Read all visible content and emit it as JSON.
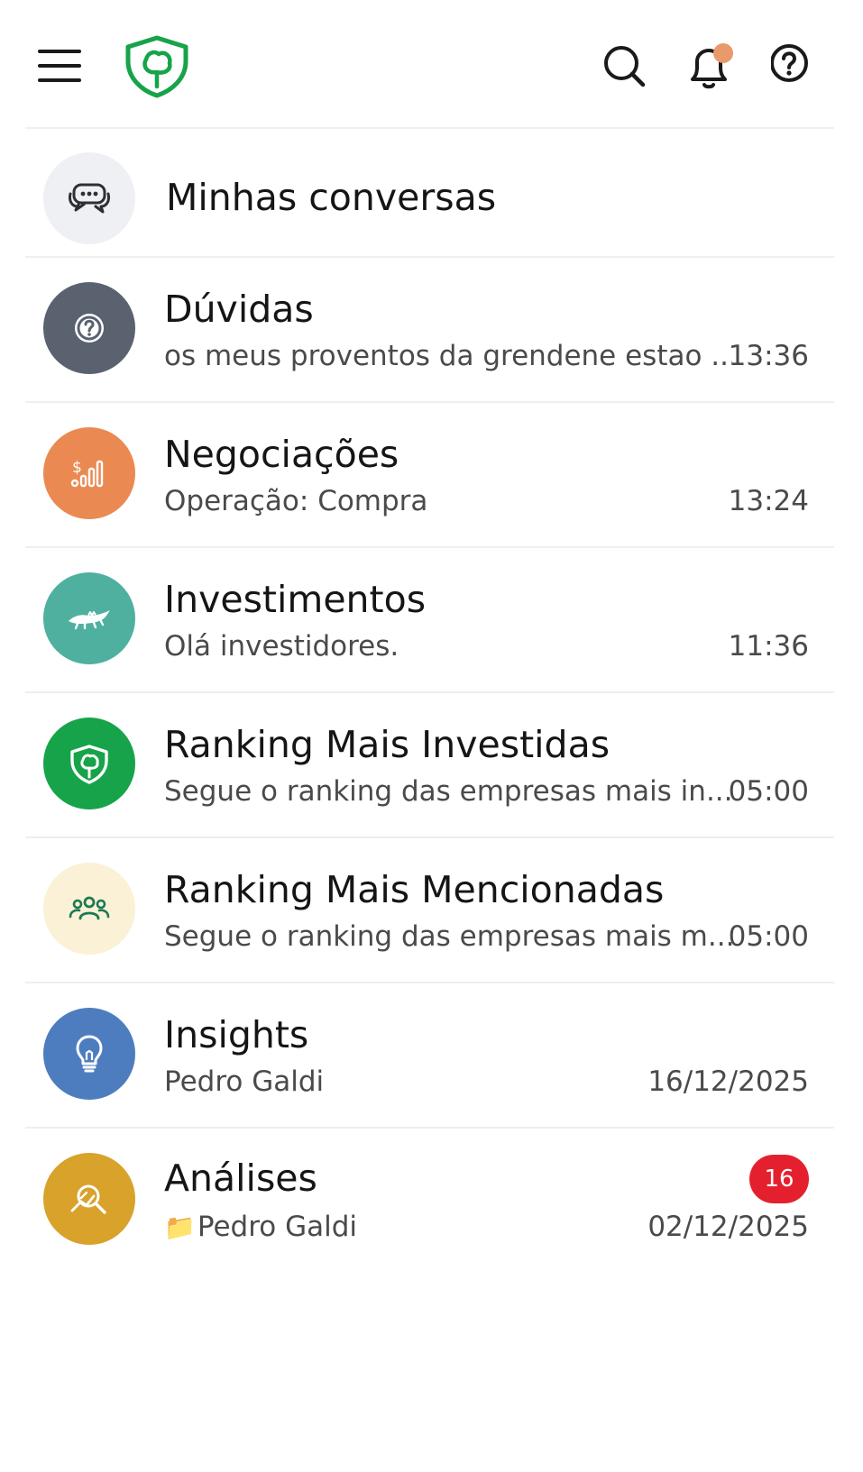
{
  "colors": {
    "brand_green": "#17a34a",
    "badge_red": "#e5202e",
    "notification_dot": "#e89a6a"
  },
  "topbar": {
    "icons": [
      "menu-icon",
      "logo-icon",
      "search-icon",
      "bell-icon",
      "help-icon"
    ]
  },
  "header": {
    "title": "Minhas conversas",
    "icon": "chat-bubbles-icon"
  },
  "conversations": [
    {
      "title": "Dúvidas",
      "subtitle": "os meus proventos da grendene estao ...",
      "time": "13:36",
      "icon": "question-icon",
      "color": "#5a6270"
    },
    {
      "title": "Negociações",
      "subtitle": "Operação: Compra",
      "time": "13:24",
      "icon": "dollar-bars-icon",
      "color": "#ea8a52"
    },
    {
      "title": "Investimentos",
      "subtitle": "Olá investidores.",
      "time": "11:36",
      "icon": "crocodile-icon",
      "color": "#4fb0a0"
    },
    {
      "title": "Ranking Mais Investidas",
      "subtitle": "Segue o ranking das empresas mais in...",
      "time": "05:00",
      "icon": "shield-tree-icon",
      "color": "#17a34a"
    },
    {
      "title": "Ranking Mais Mencionadas",
      "subtitle": "Segue o ranking das empresas mais m...",
      "time": "05:00",
      "icon": "people-icon",
      "color": "#faf1d6"
    },
    {
      "title": "Insights",
      "subtitle": "Pedro Galdi",
      "time": "16/12/2025",
      "icon": "lightbulb-icon",
      "color": "#4e7dbf"
    },
    {
      "title": "Análises",
      "subtitle": "Pedro Galdi",
      "subtitle_prefix": "📁",
      "time": "02/12/2025",
      "badge": "16",
      "icon": "magnifier-chart-icon",
      "color": "#d8a22b"
    }
  ]
}
